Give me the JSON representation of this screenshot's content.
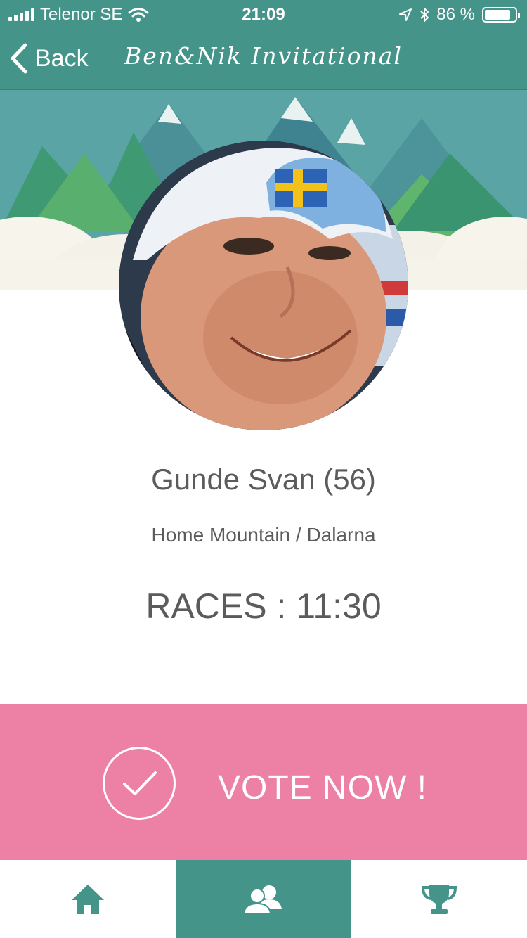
{
  "status_bar": {
    "carrier": "Telenor SE",
    "time": "21:09",
    "battery_percent": "86 %",
    "battery_level": 0.86,
    "icons": [
      "signal-icon",
      "wifi-icon",
      "location-icon",
      "bluetooth-icon",
      "battery-icon"
    ]
  },
  "nav": {
    "back_label": "Back",
    "title": "Ben&Nik Invitational"
  },
  "profile": {
    "name": "Gunde Svan (56)",
    "location": "Home Mountain / Dalarna",
    "races": "RACES : 11:30"
  },
  "vote": {
    "label": "VOTE NOW !",
    "icon": "checkmark-circle-icon"
  },
  "tabs": [
    {
      "icon": "home-icon",
      "active": false
    },
    {
      "icon": "users-icon",
      "active": true
    },
    {
      "icon": "trophy-icon",
      "active": false
    }
  ],
  "colors": {
    "primary": "#44948a",
    "vote_background": "#ed80a5",
    "text": "#5b5b5b"
  }
}
